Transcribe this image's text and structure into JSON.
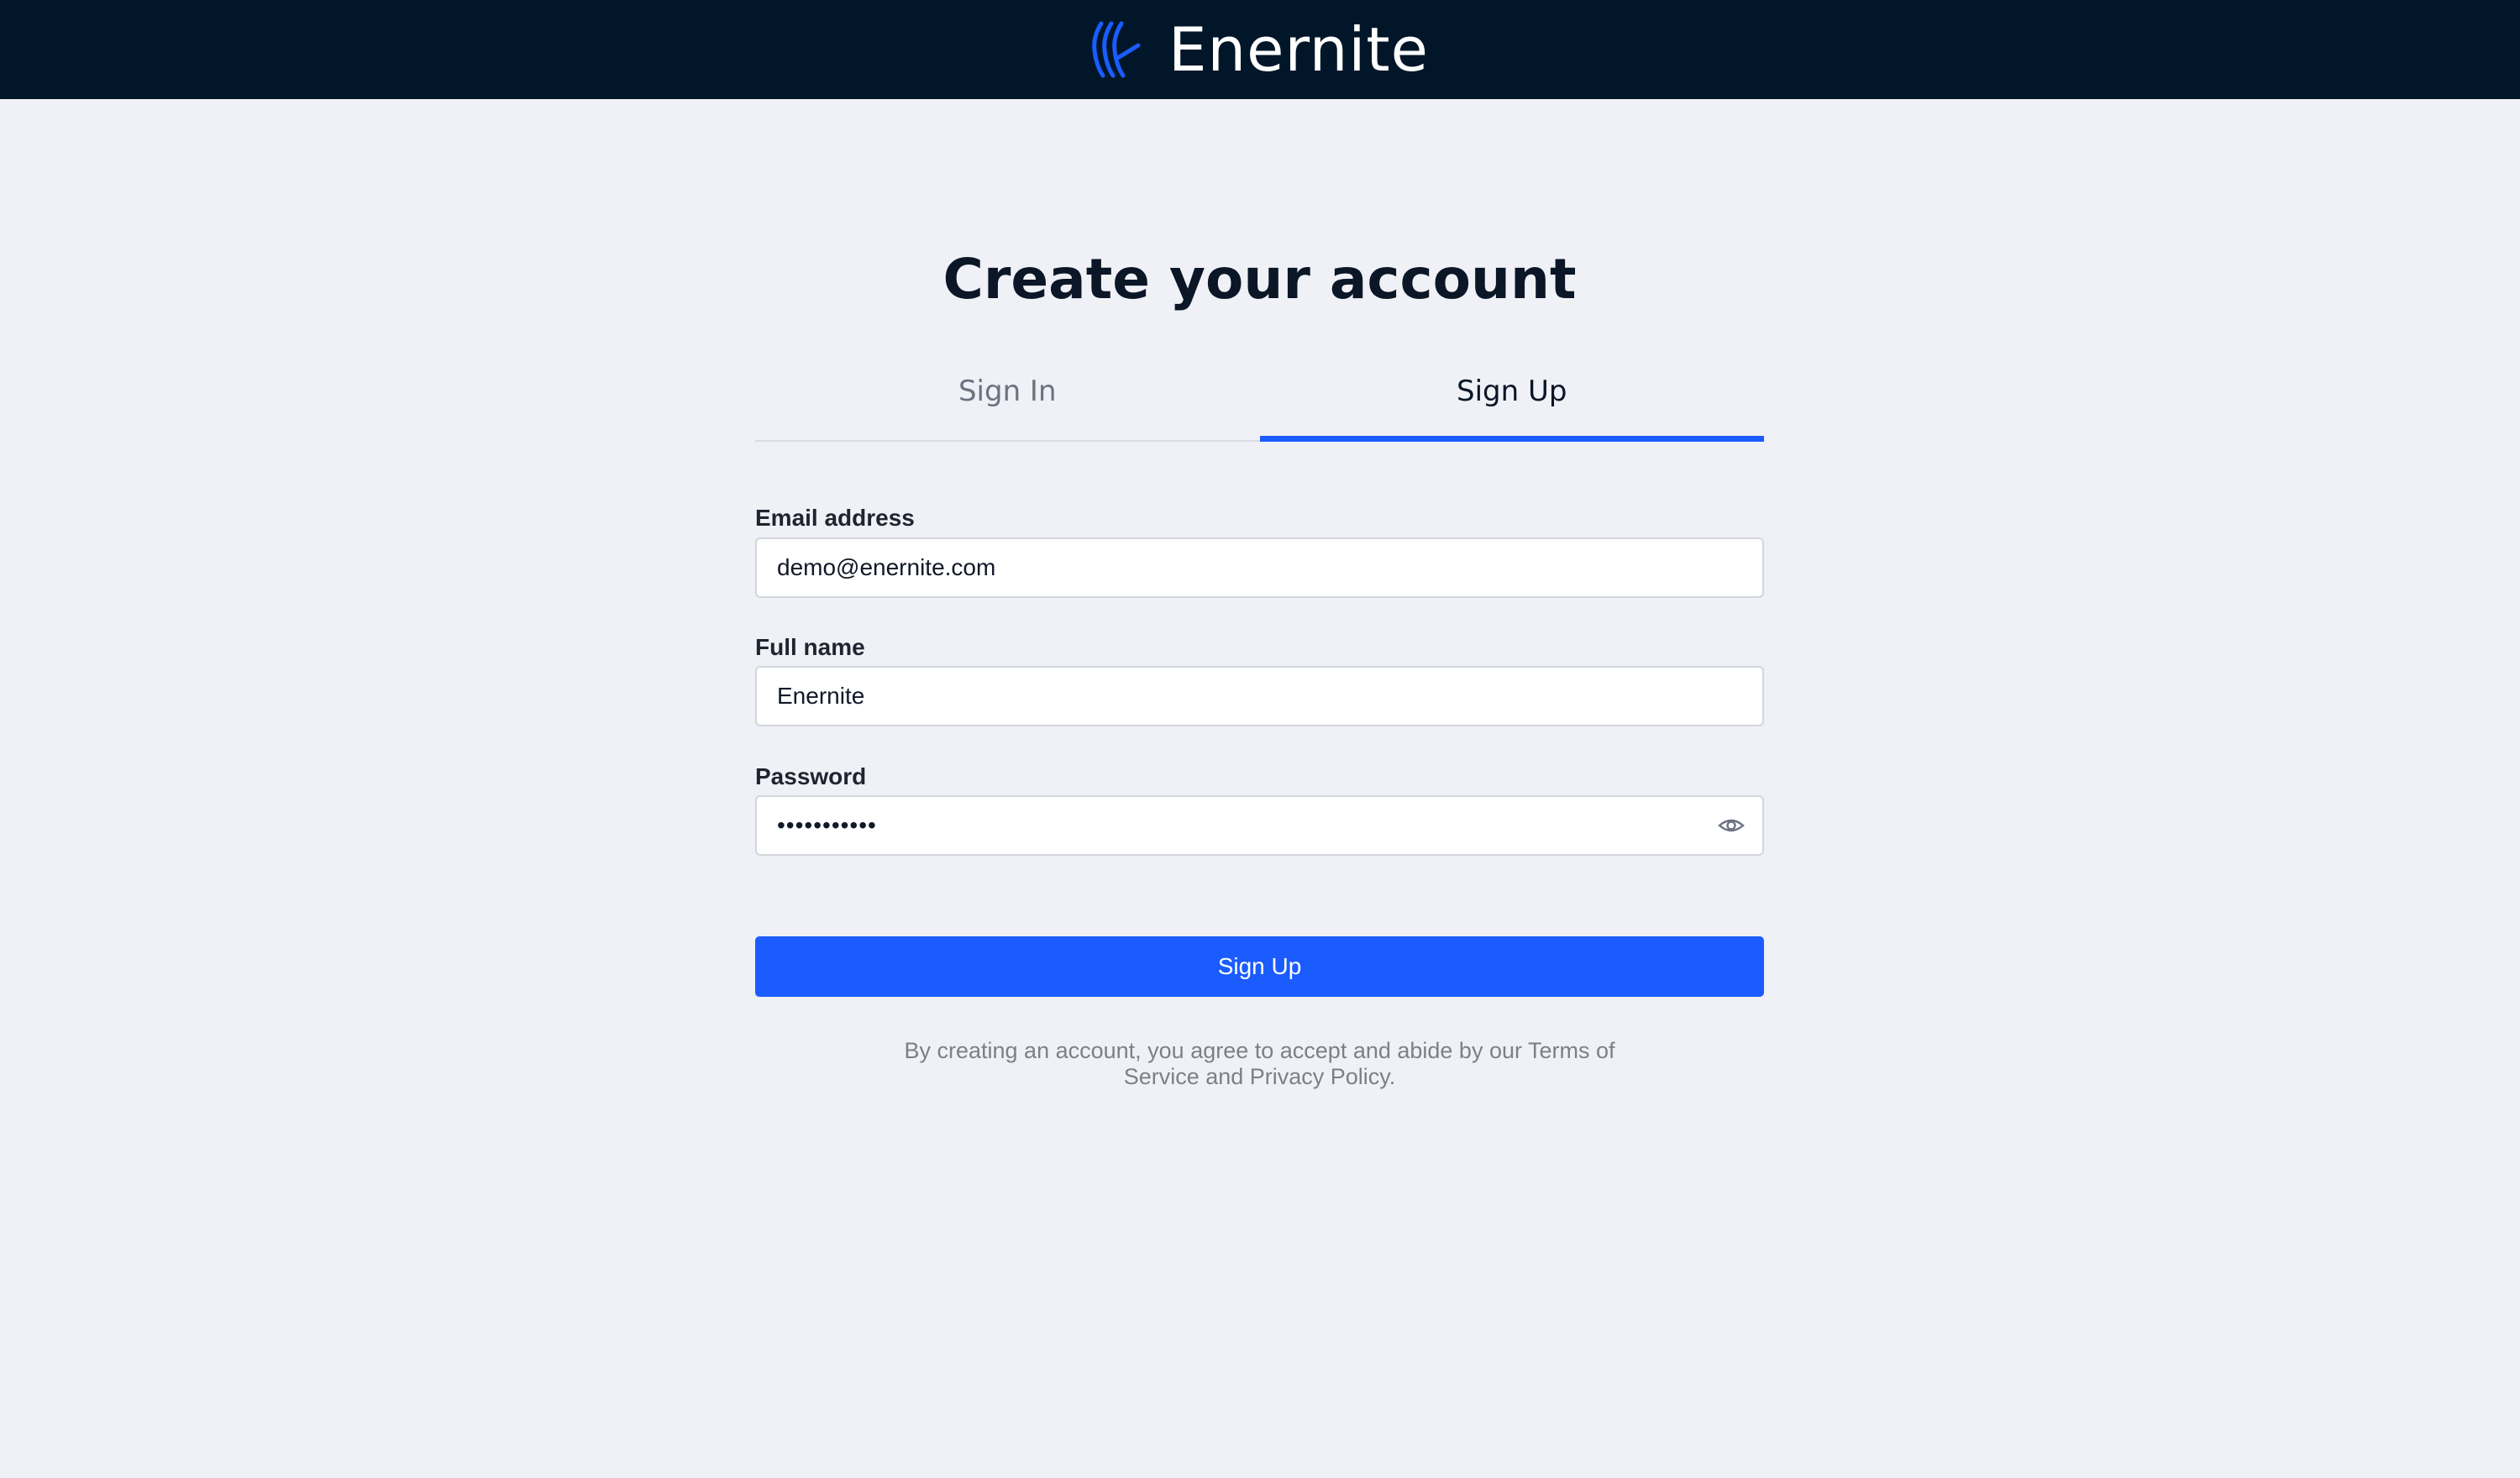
{
  "header": {
    "brand_name": "Enernite",
    "logo_icon": "enernite-logo-icon",
    "background": "#011628"
  },
  "page": {
    "title": "Create your account"
  },
  "tabs": [
    {
      "label": "Sign In",
      "active": false
    },
    {
      "label": "Sign Up",
      "active": true
    }
  ],
  "form": {
    "email": {
      "label": "Email address",
      "value": "demo@enernite.com"
    },
    "full_name": {
      "label": "Full name",
      "value": "Enernite"
    },
    "password": {
      "label": "Password",
      "value": "•••••••••••",
      "toggle_icon": "eye-icon"
    },
    "submit_label": "Sign Up"
  },
  "terms_text": "By creating an account, you agree to accept and abide by our Terms of Service and Privacy Policy.",
  "colors": {
    "accent": "#1b5cff",
    "background": "#eff1f6",
    "header": "#011628"
  }
}
